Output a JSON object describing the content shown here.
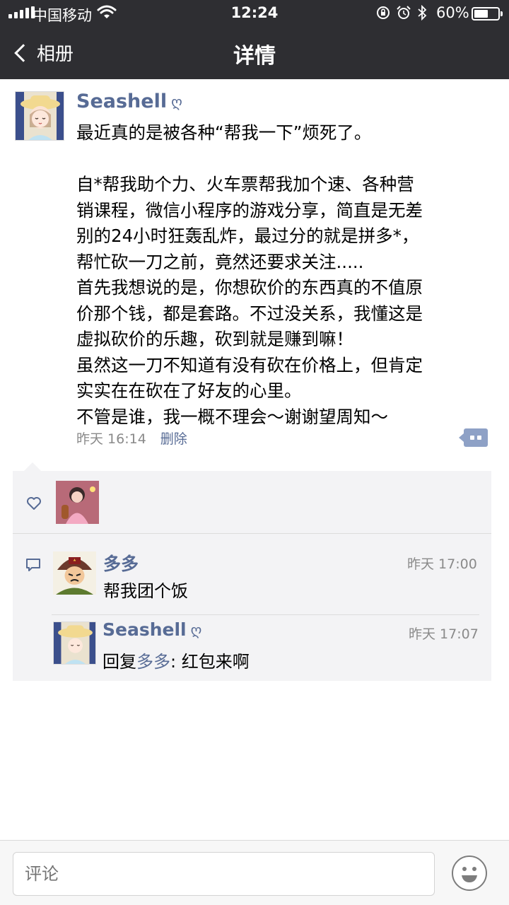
{
  "status_bar": {
    "carrier": "中国移动",
    "time": "12:24",
    "battery": "60%",
    "battery_level": 0.6
  },
  "nav": {
    "back_label": "相册",
    "title": "详情"
  },
  "post": {
    "author": "Seashell",
    "name_mark": "ღ",
    "lines": [
      "最近真的是被各种“帮我一下”烦死了。",
      "",
      "自*帮我助个力、火车票帮我加个速、各种营",
      "销课程，微信小程序的游戏分享，简直是无差",
      "别的24小时狂轰乱炸，最过分的就是拼多*，",
      "帮忙砍一刀之前，竟然还要求关注.....",
      " 首先我想说的是，你想砍价的东西真的不值原",
      "价那个钱，都是套路。不过没关系，我懂这是",
      "虚拟砍价的乐趣，砍到就是赚到嘛！",
      " 虽然这一刀不知道有没有砍在价格上，但肯定",
      "实实在在砍在了好友的心里。",
      "不管是谁，我一概不理会～谢谢望周知～"
    ],
    "time": "昨天 16:14",
    "delete_label": "删除"
  },
  "comments": [
    {
      "author": "多多",
      "time": "昨天 17:00",
      "text": "帮我团个饭"
    },
    {
      "author": "Seashell",
      "name_mark": "ღ",
      "time": "昨天 17:07",
      "reply_prefix": "回复",
      "reply_to": "多多",
      "reply_sep": ": ",
      "text": "红包来啊"
    }
  ],
  "comment_input": {
    "placeholder": "评论"
  },
  "icons": {
    "like": "heart-icon",
    "comment": "comment-bubble-icon",
    "emoji": "emoji-icon",
    "more": "more-actions-icon"
  },
  "colors": {
    "nav_bg": "#2e2e32",
    "link": "#576b95",
    "panel_bg": "#f3f3f5",
    "meta_gray": "#8a8a8a"
  }
}
